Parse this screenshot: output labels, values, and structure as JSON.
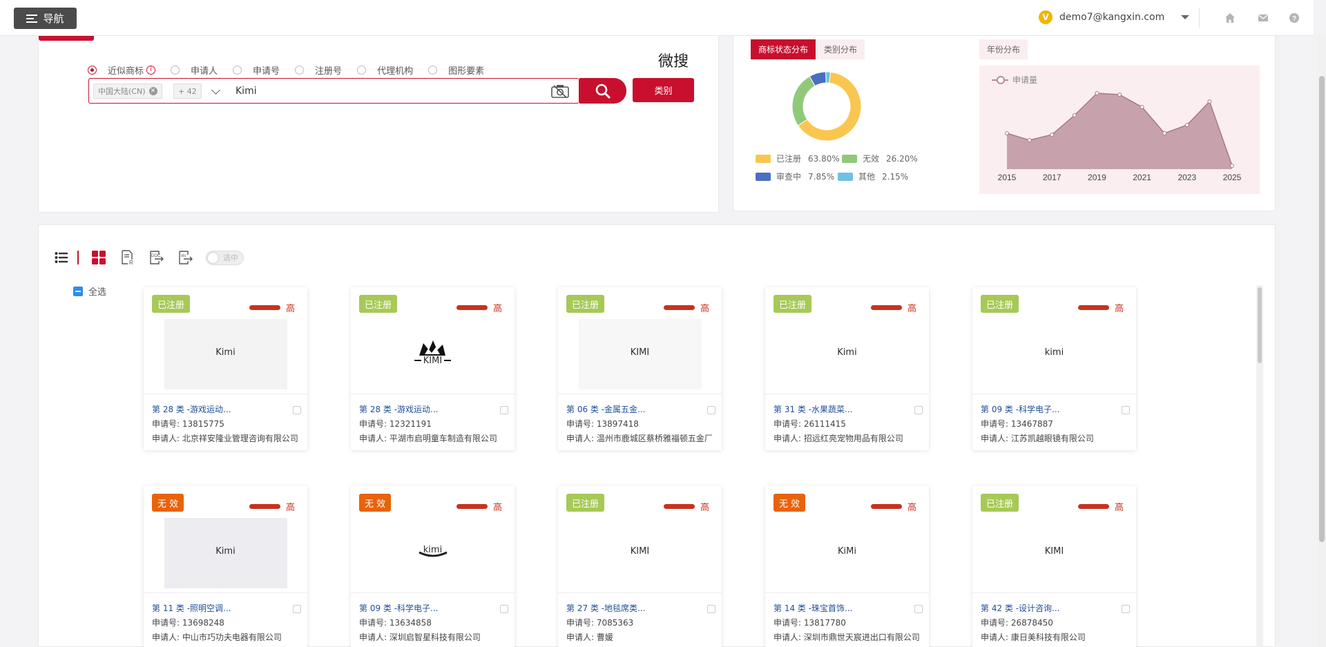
{
  "topbar": {
    "nav_label": "导航",
    "user_badge": "V",
    "user_email": "demo7@kangxin.com"
  },
  "search": {
    "brand_logo": "微搜",
    "radios": [
      {
        "label": "近似商标",
        "checked": true
      },
      {
        "label": "申请人",
        "checked": false
      },
      {
        "label": "申请号",
        "checked": false
      },
      {
        "label": "注册号",
        "checked": false
      },
      {
        "label": "代理机构",
        "checked": false
      },
      {
        "label": "图形要素",
        "checked": false
      }
    ],
    "info_icon": "i",
    "region_chip": "中国大陆(CN)",
    "more_chip": "+ 42",
    "query_value": "Kimi",
    "category_button": "类别"
  },
  "stats": {
    "tabs": [
      "商标状态分布",
      "类别分布",
      "年份分布"
    ],
    "donut_legend": [
      {
        "label": "已注册",
        "pct": "63.80%",
        "color": "#f9c74f",
        "value": 63.8
      },
      {
        "label": "无效",
        "pct": "26.20%",
        "color": "#90c978",
        "value": 26.2
      },
      {
        "label": "审查中",
        "pct": "7.85%",
        "color": "#4a6fc1",
        "value": 7.85
      },
      {
        "label": "其他",
        "pct": "2.15%",
        "color": "#6ec1e4",
        "value": 2.15
      }
    ],
    "line_legend": "申请量",
    "year_ticks": [
      "2015",
      "2017",
      "2019",
      "2021",
      "2023",
      "2025"
    ]
  },
  "chart_data": [
    {
      "type": "pie",
      "labels": [
        "已注册",
        "无效",
        "审查中",
        "其他"
      ],
      "values": [
        63.8,
        26.2,
        7.85,
        2.15
      ]
    },
    {
      "type": "area",
      "x": [
        2015,
        2016,
        2017,
        2018,
        2019,
        2020,
        2021,
        2022,
        2023,
        2024,
        2025
      ],
      "series": [
        {
          "name": "申请量",
          "values": [
            52,
            42,
            50,
            78,
            110,
            108,
            90,
            52,
            64,
            98,
            5
          ]
        }
      ],
      "xlabel": "",
      "ylabel": ""
    }
  ],
  "results": {
    "toggle_label": "选中",
    "select_all": "全选",
    "applicant_no_prefix": "申请号: ",
    "applicant_prefix": "申请人: ",
    "cards": [
      {
        "status": "已注册",
        "status_type": "reg",
        "level": "高",
        "mark": "Kimi",
        "style": "kimi-bold-grey",
        "class": "第 28 类 -游戏运动...",
        "app_no": "13815775",
        "applicant": "北京祥安隆业管理咨询有限公司"
      },
      {
        "status": "已注册",
        "status_type": "reg",
        "level": "高",
        "mark": "KIMI",
        "style": "crown-small",
        "class": "第 28 类 -游戏运动...",
        "app_no": "12321191",
        "applicant": "平湖市启明童车制造有限公司"
      },
      {
        "status": "已注册",
        "status_type": "reg",
        "level": "高",
        "mark": "KIMI",
        "style": "serif-bold-big",
        "class": "第 06 类 -金属五金...",
        "app_no": "13897418",
        "applicant": "温州市鹿城区蔡桥雅福顿五金厂"
      },
      {
        "status": "已注册",
        "status_type": "reg",
        "level": "高",
        "mark": "Kimi",
        "style": "serif-small",
        "class": "第 31 类 -水果蔬菜...",
        "app_no": "26111415",
        "applicant": "招远红亮宠物用品有限公司"
      },
      {
        "status": "已注册",
        "status_type": "reg",
        "level": "高",
        "mark": "kimi",
        "style": "serif-spaced",
        "class": "第 09 类 -科学电子...",
        "app_no": "13467887",
        "applicant": "江苏凯越眼镜有限公司"
      },
      {
        "status": "无 效",
        "status_type": "inv",
        "level": "高",
        "mark": "Kimi",
        "style": "kimi-grey-wide",
        "class": "第 11 类 -照明空调...",
        "app_no": "13698248",
        "applicant": "中山市巧功夫电器有限公司"
      },
      {
        "status": "无 效",
        "status_type": "inv",
        "level": "高",
        "mark": "kimi",
        "style": "kimi-smile",
        "class": "第 09 类 -科学电子...",
        "app_no": "13634858",
        "applicant": "深圳启智星科技有限公司"
      },
      {
        "status": "已注册",
        "status_type": "reg",
        "level": "高",
        "mark": "KIMI",
        "style": "sans-condensed",
        "class": "第 27 类 -地毯席类...",
        "app_no": "7085363",
        "applicant": "曹媛"
      },
      {
        "status": "无 效",
        "status_type": "inv",
        "level": "高",
        "mark": "KiMi",
        "style": "kimi-black-bold",
        "class": "第 14 类 -珠宝首饰...",
        "app_no": "13817780",
        "applicant": "深圳市鼎世天宸进出口有限公司"
      },
      {
        "status": "已注册",
        "status_type": "reg",
        "level": "高",
        "mark": "KIMI",
        "style": "serif-light",
        "class": "第 42 类 -设计咨询...",
        "app_no": "26878450",
        "applicant": "康日美科技有限公司"
      }
    ]
  }
}
